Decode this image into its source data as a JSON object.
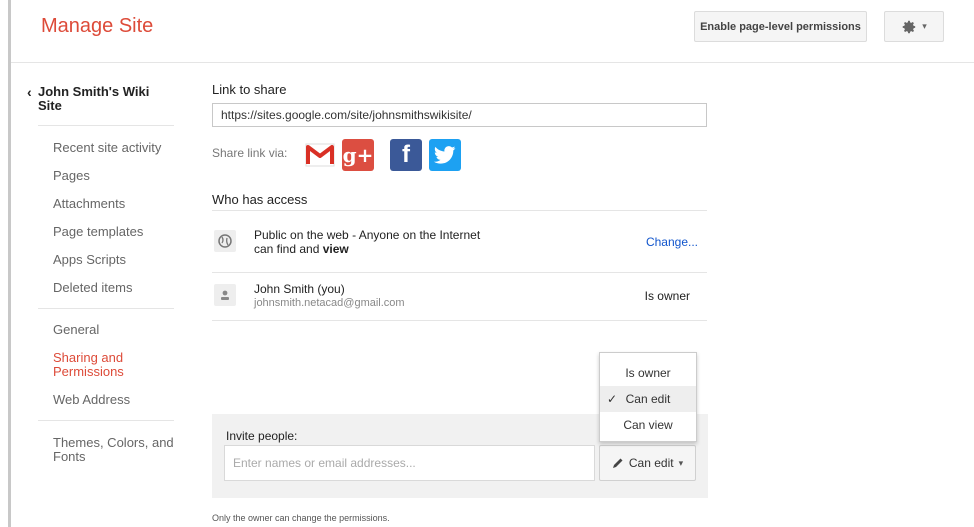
{
  "header": {
    "title": "Manage Site",
    "permissions_button": "Enable page-level permissions",
    "gear_caret": "▾"
  },
  "sidebar": {
    "site_name": "John Smith's Wiki Site",
    "items": [
      "Recent site activity",
      "Pages",
      "Attachments",
      "Page templates",
      "Apps Scripts",
      "Deleted items",
      "General",
      "Sharing and Permissions",
      "Web Address",
      "Themes, Colors, and Fonts"
    ],
    "active_item": "Sharing and Permissions"
  },
  "share": {
    "link_label": "Link to share",
    "link_url": "https://sites.google.com/site/johnsmithswikisite/",
    "via_label": "Share link via:",
    "services": [
      "gmail",
      "google-plus",
      "facebook",
      "twitter"
    ]
  },
  "access": {
    "heading": "Who has access",
    "public_line1": "Public on the web - Anyone on the Internet",
    "public_line2_prefix": "can find and ",
    "public_line2_bold": "view",
    "public_action": "Change...",
    "owner_name": "John Smith (you)",
    "owner_email": "johnsmith.netacad@gmail.com",
    "owner_role": "Is owner"
  },
  "role_menu": {
    "options": [
      "Is owner",
      "Can edit",
      "Can view"
    ],
    "selected": "Can edit"
  },
  "invite": {
    "label": "Invite people:",
    "placeholder": "Enter names or email addresses...",
    "role_label": "Can edit"
  },
  "footer_note": "Only the owner can change the permissions.",
  "colors": {
    "brand_red": "#dd4b39",
    "link_blue": "#1155cc",
    "gmail_red": "#d93025",
    "gplus_red": "#dc4e41",
    "facebook_blue": "#3b5998",
    "twitter_blue": "#1da1f2"
  }
}
